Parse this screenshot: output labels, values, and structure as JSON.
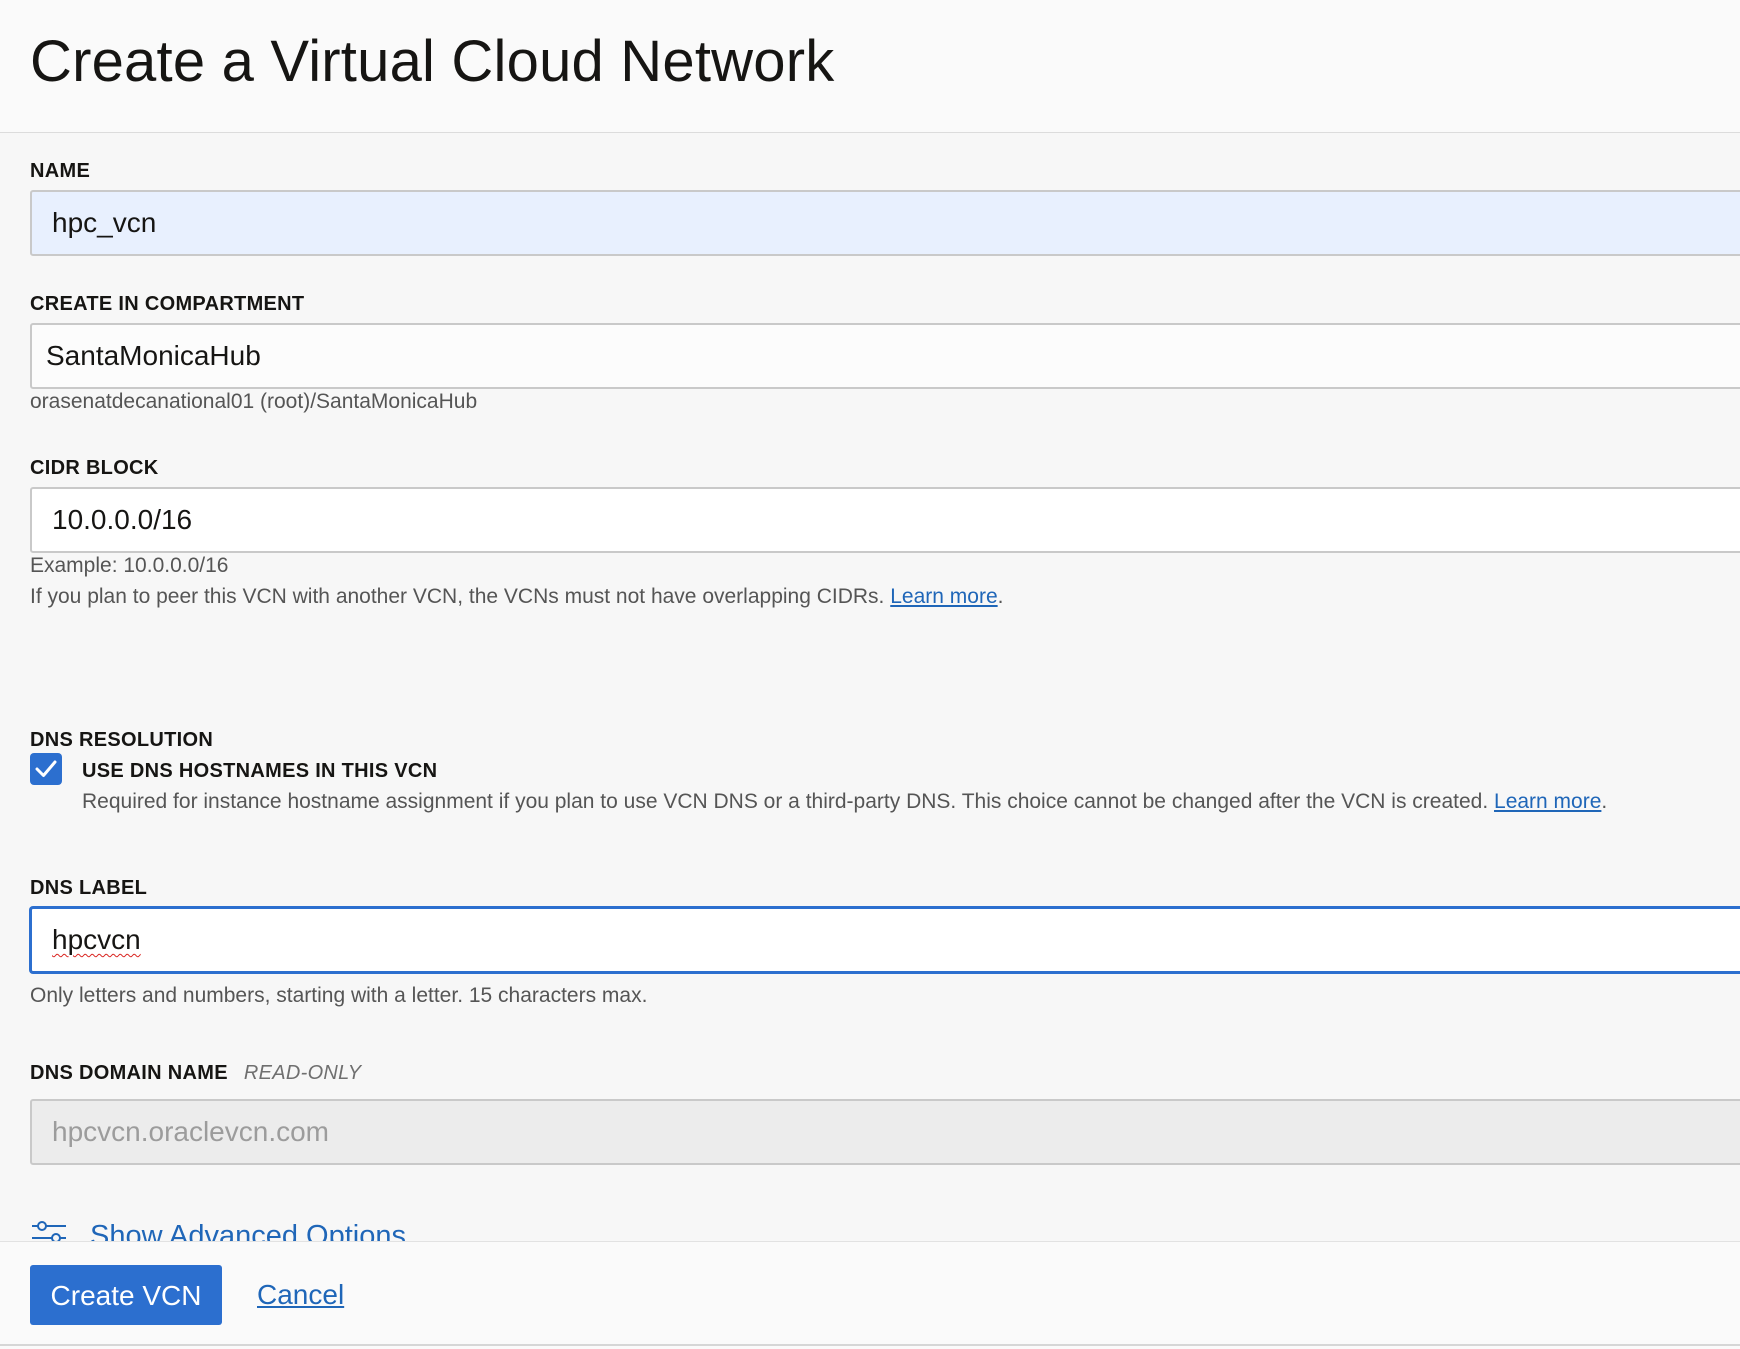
{
  "header": {
    "title": "Create a Virtual Cloud Network"
  },
  "form": {
    "name": {
      "label": "NAME",
      "value": "hpc_vcn"
    },
    "compartment": {
      "label": "CREATE IN COMPARTMENT",
      "value": "SantaMonicaHub",
      "path": "orasenatdecanational01 (root)/SantaMonicaHub"
    },
    "cidr": {
      "label": "CIDR BLOCK",
      "value": "10.0.0.0/16",
      "example": "Example: 10.0.0.0/16",
      "peer_note": "If you plan to peer this VCN with another VCN, the VCNs must not have overlapping CIDRs.",
      "learn_more": "Learn more",
      "period": "."
    },
    "dns_resolution": {
      "label": "DNS RESOLUTION",
      "checkbox_label": "USE DNS HOSTNAMES IN THIS VCN",
      "checked": true,
      "help": "Required for instance hostname assignment if you plan to use VCN DNS or a third-party DNS. This choice cannot be changed after the VCN is created.",
      "learn_more": "Learn more",
      "period": "."
    },
    "dns_label": {
      "label": "DNS LABEL",
      "value": "hpcvcn",
      "help": "Only letters and numbers, starting with a letter. 15 characters max."
    },
    "dns_domain": {
      "label": "DNS DOMAIN NAME",
      "readonly_tag": "READ-ONLY",
      "value": "hpcvcn.oraclevcn.com"
    },
    "advanced": {
      "label": "Show Advanced Options",
      "icon": "sliders-icon"
    }
  },
  "footer": {
    "create_label": "Create VCN",
    "cancel_label": "Cancel"
  },
  "colors": {
    "accent": "#2c6fcf",
    "link": "#1f66b8",
    "autofill_bg": "#e8f0fe",
    "readonly_bg": "#ececec"
  }
}
